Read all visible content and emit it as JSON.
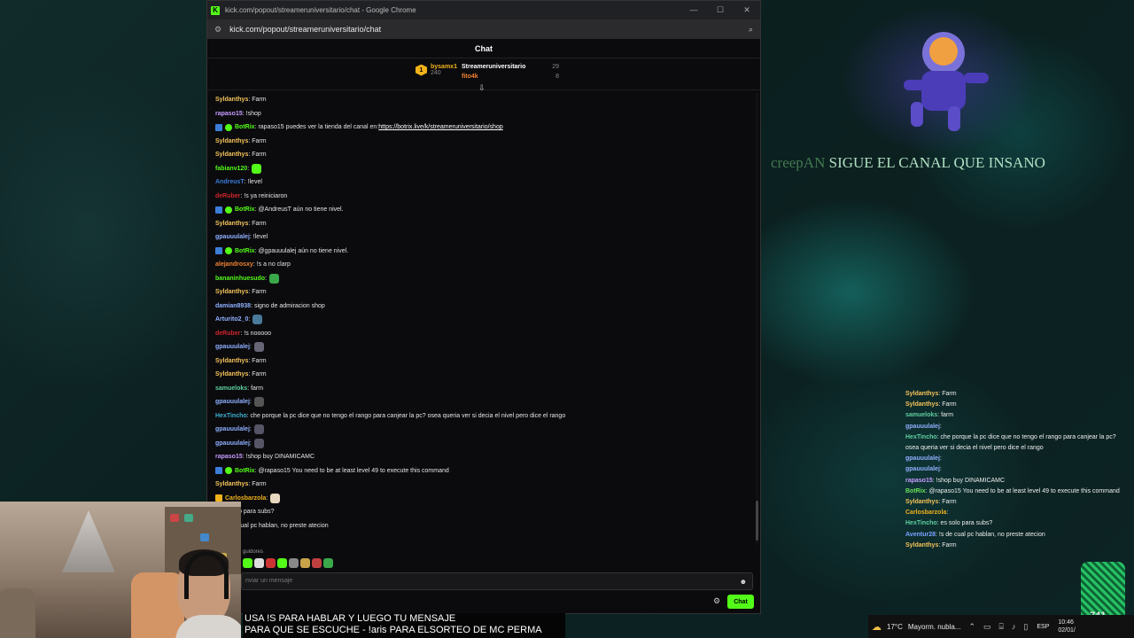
{
  "window": {
    "title": "kick.com/popout/streameruniversitario/chat - Google Chrome",
    "url": "kick.com/popout/streameruniversitario/chat",
    "controls": [
      "—",
      "☐",
      "✕"
    ]
  },
  "chat": {
    "header": "Chat",
    "leaderboard": {
      "first": {
        "rank": "1",
        "name": "bysamx1",
        "points": "240"
      },
      "second": {
        "name": "Streameruniversitario",
        "points": "29"
      },
      "third": {
        "name": "fito4k",
        "points": "8"
      }
    },
    "messages": [
      {
        "user": "Syldanthys",
        "color": "#f4c35a",
        "text": ": Farm"
      },
      {
        "user": "rapaso15",
        "color": "#c89cff",
        "text": ": !shop"
      },
      {
        "user": "BotRix",
        "color": "#53fc18",
        "bot": true,
        "text": ": rapaso15 puedes ver la tienda del canal en: ",
        "link": "https://botrix.live/k/streameruniversitario/shop"
      },
      {
        "user": "Syldanthys",
        "color": "#f4c35a",
        "text": ": Farm"
      },
      {
        "user": "Syldanthys",
        "color": "#f4c35a",
        "text": ": Farm"
      },
      {
        "user": "fabianv120",
        "color": "#53fc18",
        "text": ":",
        "emote": "#53fc18"
      },
      {
        "user": "AndreusT",
        "color": "#3b7dd8",
        "text": ": !level"
      },
      {
        "user": "deRuber",
        "color": "#d0242c",
        "text": ": !s ya reiniciaron"
      },
      {
        "user": "BotRix",
        "color": "#53fc18",
        "bot": true,
        "text": ": @AndreusT aún no tiene nivel."
      },
      {
        "user": "Syldanthys",
        "color": "#f4c35a",
        "text": ": Farm"
      },
      {
        "user": "gpauuulalej",
        "color": "#8fb0ff",
        "text": ": !level"
      },
      {
        "user": "BotRix",
        "color": "#53fc18",
        "bot": true,
        "text": ": @gpauuulalej aún no tiene nivel."
      },
      {
        "user": "alejandrosxy",
        "color": "#f08030",
        "text": ": !s a no clarp"
      },
      {
        "user": "bananinhuesudo",
        "color": "#53fc18",
        "text": ":",
        "emote": "#3aa84a"
      },
      {
        "user": "Syldanthys",
        "color": "#f4c35a",
        "text": ": Farm"
      },
      {
        "user": "damian8938",
        "color": "#8fb0ff",
        "text": ": signo de admiracion shop"
      },
      {
        "user": "Arturito2_0",
        "color": "#8fb0ff",
        "text": ":",
        "emote": "#4a7a9a"
      },
      {
        "user": "deRuber",
        "color": "#d0242c",
        "text": ": !s nooooo"
      },
      {
        "user": "gpauuulalej",
        "color": "#8fb0ff",
        "text": ":",
        "emote": "#667"
      },
      {
        "user": "Syldanthys",
        "color": "#f4c35a",
        "text": ": Farm"
      },
      {
        "user": "Syldanthys",
        "color": "#f4c35a",
        "text": ": Farm"
      },
      {
        "user": "samueloks",
        "color": "#5fd0a0",
        "text": ": farm"
      },
      {
        "user": "gpauuulalej",
        "color": "#8fb0ff",
        "text": ":",
        "emote": "#555"
      },
      {
        "user": "HexTincho",
        "color": "#3ab0d0",
        "text": ": che porque la pc dice que no tengo el rango para canjear la pc? osea queria ver si decia el nivel pero dice el rango"
      },
      {
        "user": "gpauuulalej",
        "color": "#8fb0ff",
        "text": ":",
        "emote": "#556"
      },
      {
        "user": "gpauuulalej",
        "color": "#8fb0ff",
        "text": ":",
        "emote": "#556"
      },
      {
        "user": "rapaso15",
        "color": "#c89cff",
        "text": ": !shop buy DINAMICAMC"
      },
      {
        "user": "BotRix",
        "color": "#53fc18",
        "bot": true,
        "text": ": @rapaso15 You need to be at least level 49 to execute this command"
      },
      {
        "user": "Syldanthys",
        "color": "#f4c35a",
        "text": ": Farm"
      },
      {
        "user": "Carlosbarzola",
        "color": "#f2b21b",
        "crown": true,
        "text": ":",
        "emote": "#e8d8c0"
      },
      {
        "user": "",
        "color": "#3ab0d0",
        "text": "a: es solo para subs?"
      },
      {
        "user": "",
        "color": "#3b7dd8",
        "text": "8: !s de cual pc hablan, no preste atecion"
      },
      {
        "user": "",
        "color": "#f4c35a",
        "text": "ys: Farm"
      }
    ],
    "emote_section_label": "guidores",
    "input_placeholder": "nviar un mensaje",
    "send_label": "Chat"
  },
  "overlay_title": {
    "user": "creepAN",
    "text": "SIGUE EL CANAL QUE INSANO"
  },
  "ticker": {
    "line1": "USA !S PARA HABLAR Y LUEGO TU MENSAJE",
    "line2": "PARA QUE SE ESCUCHE - !aris PARA ELSORTEO DE MC PERMA"
  },
  "overlay_chat": [
    {
      "user": "Syldanthys",
      "cls": "y",
      "text": ": Farm"
    },
    {
      "user": "Syldanthys",
      "cls": "y",
      "text": ": Farm"
    },
    {
      "user": "samueloks",
      "cls": "g",
      "text": ": farm"
    },
    {
      "user": "gpauuulalej",
      "cls": "b",
      "text": ": "
    },
    {
      "user": "HexTincho",
      "cls": "g",
      "text": ": che porque la pc dice que no tengo el rango para canjear la pc? osea queria ver si decia el nivel pero dice el rango"
    },
    {
      "user": "gpauuulalej",
      "cls": "b",
      "text": ": "
    },
    {
      "user": "gpauuulalej",
      "cls": "b",
      "text": ": "
    },
    {
      "user": "rapaso15",
      "cls": "p",
      "text": ": !shop buy DINAMICAMC"
    },
    {
      "user": "BotRix",
      "cls": "gr",
      "text": ": @rapaso15 You need to be at least level 49 to execute this command"
    },
    {
      "user": "Syldanthys",
      "cls": "y",
      "text": ": Farm"
    },
    {
      "user": "Carlosbarzola",
      "cls": "or",
      "text": ": "
    },
    {
      "user": "HexTincho",
      "cls": "g",
      "text": ": es solo para subs?"
    },
    {
      "user": "Aventur28",
      "cls": "bl",
      "text": ": !s de cual pc hablan, no preste atecion"
    },
    {
      "user": "Syldanthys",
      "cls": "y",
      "text": ": Farm"
    }
  ],
  "taskbar": {
    "temperature": "17°C",
    "weather": "Mayorm. nubla...",
    "language": "ESP",
    "time": "10:46",
    "date": "02/01/"
  },
  "widget_label": "741"
}
